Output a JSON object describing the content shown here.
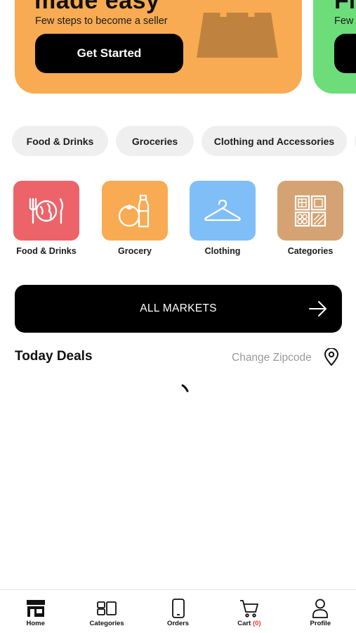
{
  "banners": [
    {
      "title": "made easy",
      "subtitle": "Few steps to become a seller",
      "button_label": "Get Started",
      "color": "#f8ab52",
      "icon": "shopping-bag-icon"
    },
    {
      "title": "Fi",
      "subtitle": "Few",
      "color": "#6cdd79"
    }
  ],
  "chips": [
    "Food & Drinks",
    "Groceries",
    "Clothing and Accessories"
  ],
  "tiles": [
    {
      "label": "Food & Drinks",
      "icon": "plate-cutlery-icon",
      "color": "#ec6469"
    },
    {
      "label": "Grocery",
      "icon": "tomato-bottle-icon",
      "color": "#f8ab52"
    },
    {
      "label": "Clothing",
      "icon": "hanger-icon",
      "color": "#7fbef6"
    },
    {
      "label": "Categories",
      "icon": "grid-categories-icon",
      "color": "#d5a373"
    }
  ],
  "all_markets": {
    "label": "ALL MARKETS",
    "icon": "arrow-right-icon"
  },
  "deals": {
    "title": "Today Deals",
    "zipcode_label": "Change Zipcode",
    "icon": "location-pin-icon"
  },
  "nav": {
    "items": [
      {
        "label": "Home",
        "icon": "store-icon"
      },
      {
        "label": "Categories",
        "icon": "categories-icon"
      },
      {
        "label": "Orders",
        "icon": "phone-icon"
      },
      {
        "label": "Cart",
        "icon": "cart-icon",
        "count": "(0)"
      },
      {
        "label": "Profile",
        "icon": "user-icon"
      }
    ]
  }
}
